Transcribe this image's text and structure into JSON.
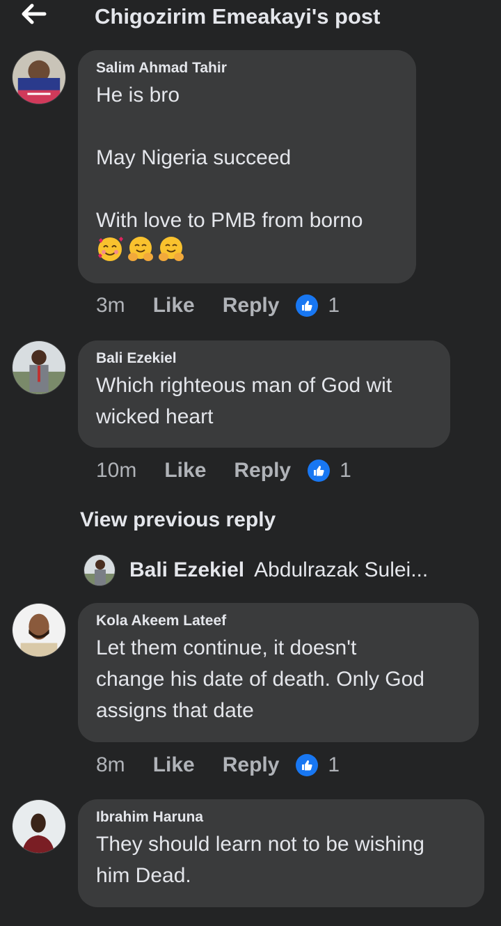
{
  "header": {
    "title": "Chigozirim Emeakayi's post",
    "back_icon": "arrow-left-icon"
  },
  "comments": [
    {
      "author": "Salim Ahmad Tahir",
      "text": "He is bro\n\nMay Nigeria succeed\n\nWith love to PMB from borno",
      "emojis": [
        "smiling-face-with-hearts",
        "hugging-face",
        "hugging-face"
      ],
      "time": "3m",
      "like_label": "Like",
      "reply_label": "Reply",
      "reaction_count": "1"
    },
    {
      "author": "Bali Ezekiel",
      "text": "Which righteous man of God wit\nwicked heart",
      "time": "10m",
      "like_label": "Like",
      "reply_label": "Reply",
      "reaction_count": "1"
    },
    {
      "author": "Kola Akeem Lateef",
      "text": "Let them continue, it doesn't\nchange his date of death. Only God\nassigns that date",
      "time": "8m",
      "like_label": "Like",
      "reply_label": "Reply",
      "reaction_count": "1"
    },
    {
      "author": "Ibrahim Haruna",
      "text": "They should learn not to be wishing\nhim Dead."
    }
  ],
  "view_previous_reply": "View previous reply",
  "reply_preview": {
    "name": "Bali Ezekiel",
    "snippet": "Abdulrazak Sulei..."
  },
  "colors": {
    "background": "#232425",
    "bubble": "#3a3b3c",
    "like_blue": "#1877f2",
    "muted": "#b0b3b8"
  }
}
